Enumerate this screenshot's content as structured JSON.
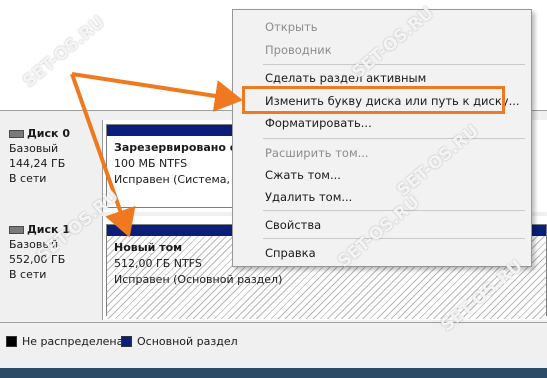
{
  "disks": [
    {
      "name": "Диск 0",
      "type": "Базовый",
      "size": "144,24 ГБ",
      "status": "В сети"
    },
    {
      "name": "Диск 1",
      "type": "Базовый",
      "size": "552,00 ГБ",
      "status": "В сети"
    }
  ],
  "partitions": {
    "reserved": {
      "name": "Зарезервировано с",
      "size": "100 МБ NTFS",
      "status": "Исправен (Система,"
    },
    "new_volume": {
      "name": "Новый том",
      "size": "512,00 ГБ NTFS",
      "status": "Исправен (Основной раздел)"
    }
  },
  "legend": [
    {
      "label": "Не распределена",
      "color": "#000000"
    },
    {
      "label": "Основной раздел",
      "color": "#0a1e7a"
    }
  ],
  "context_menu": {
    "items": [
      {
        "label": "Открыть",
        "disabled": true
      },
      {
        "label": "Проводник",
        "disabled": true
      },
      {
        "label": "Сделать раздел активным",
        "disabled": false
      },
      {
        "label": "Изменить букву диска или путь к диску...",
        "disabled": false
      },
      {
        "label": "Форматировать...",
        "disabled": false
      },
      {
        "label": "Расширить том...",
        "disabled": true
      },
      {
        "label": "Сжать том...",
        "disabled": false
      },
      {
        "label": "Удалить том...",
        "disabled": false
      },
      {
        "label": "Свойства",
        "disabled": false
      },
      {
        "label": "Справка",
        "disabled": false
      }
    ]
  },
  "annotation": {
    "color": "#f0791f"
  },
  "watermark": "SET-OS.RU"
}
